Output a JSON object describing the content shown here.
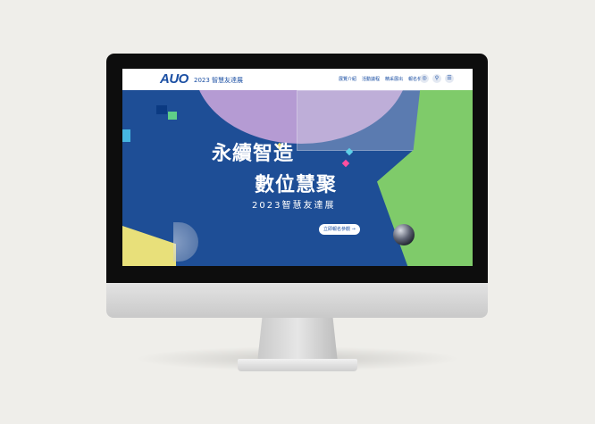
{
  "header": {
    "logo_text": "AUO",
    "event_label": "2023 智慧友達展",
    "nav_links": [
      "展覽介紹",
      "活動議程",
      "精采展出",
      "報名參加"
    ],
    "icons": [
      "globe-icon",
      "search-icon",
      "menu-icon"
    ]
  },
  "hero": {
    "headline_line1": "永續智造",
    "headline_line2": "數位慧聚",
    "subtitle": "2023智慧友達展",
    "cta_label": "立即報名參觀 →"
  },
  "colors": {
    "brand_blue": "#1b4fa3",
    "hero_background": "#1e4e96",
    "accent_green": "#7fcb6a",
    "accent_purple": "#b59bd3",
    "accent_yellow": "#e8e07a"
  }
}
